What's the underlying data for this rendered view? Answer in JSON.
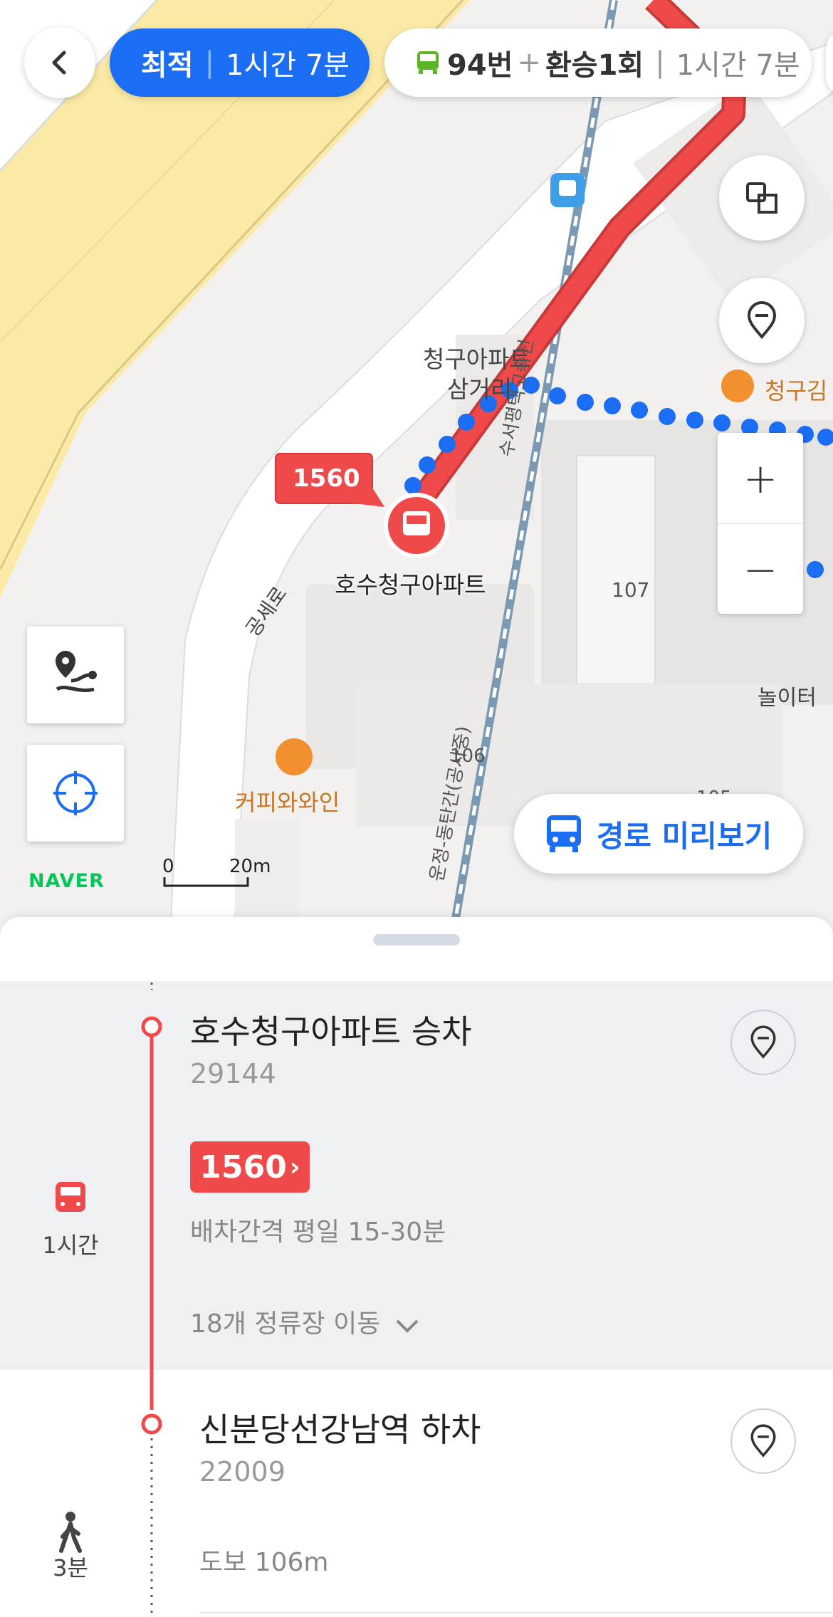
{
  "header": {
    "back_icon": "chevron-left-icon",
    "tab_best": {
      "label": "최적",
      "time": "1시간 7분"
    },
    "tab_route": {
      "bus": "94번",
      "plus": "+",
      "transfer": "환승1회",
      "time": "1시간 7분"
    }
  },
  "map": {
    "labels": {
      "poi_intersection_1": "청구아파트",
      "poi_intersection_2": "삼거리",
      "road_gongse": "공세로",
      "road_suseo": "수서평택고속선",
      "rail_dongtan": "운정-동탄간(공사중)",
      "cafe": "커피와와인",
      "restaurant": "청구김",
      "stop_name": "호수청구아파트",
      "bldg_107": "107",
      "bldg_106": "106",
      "bldg_105": "105",
      "playground": "놀이터"
    },
    "bus_callout": "1560",
    "scale_zero": "0",
    "scale_length": "20m",
    "brand": "NAVER",
    "controls": {
      "layers_icon": "layers-icon",
      "pin_icon": "location-pin-icon",
      "zoom_in": "+",
      "zoom_out": "−",
      "route_icon": "route-icon",
      "locate_icon": "crosshair-icon"
    },
    "preview_button": "경로 미리보기"
  },
  "sheet": {
    "board": {
      "title": "호수청구아파트 승차",
      "code": "29144",
      "bus_number": "1560",
      "interval": "배차간격 평일 15-30분",
      "stops": "18개 정류장 이동",
      "mode_duration": "1시간"
    },
    "alight": {
      "title": "신분당선강남역 하차",
      "code": "22009",
      "walk": "도보 106m",
      "mode_duration": "3분"
    }
  },
  "colors": {
    "accent": "#1b6ef3",
    "route_red": "#f0494a",
    "walk_blue": "#1b6ef3",
    "naver_green": "#03c75a"
  }
}
